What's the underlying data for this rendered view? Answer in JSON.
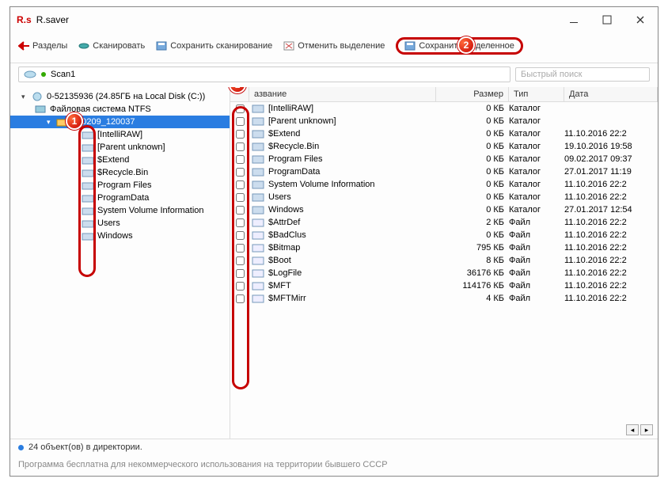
{
  "app": {
    "logo": "R.s",
    "title": "R.saver"
  },
  "toolbar": {
    "back": "Разделы",
    "scan": "Сканировать",
    "save_scan": "Сохранить сканирование",
    "deselect": "Отменить выделение",
    "save_selected": "Сохранить выделенное"
  },
  "path": {
    "scan_name": "Scan1"
  },
  "search": {
    "placeholder": "Быстрый поиск"
  },
  "tree": {
    "root": "0-52135936 (24.85ГБ на Local Disk (C:))",
    "fs": "Файловая система NTFS",
    "scan_folder": "170209_120037",
    "items": [
      "[IntelliRAW]",
      "[Parent unknown]",
      "$Extend",
      "$Recycle.Bin",
      "Program Files",
      "ProgramData",
      "System Volume Information",
      "Users",
      "Windows"
    ]
  },
  "columns": {
    "name": "азвание",
    "size": "Размер",
    "type": "Тип",
    "date": "Дата"
  },
  "rows": [
    {
      "name": "[IntelliRAW]",
      "size": "0 КБ",
      "type": "Каталог",
      "date": "",
      "folder": true
    },
    {
      "name": "[Parent unknown]",
      "size": "0 КБ",
      "type": "Каталог",
      "date": "",
      "folder": true
    },
    {
      "name": "$Extend",
      "size": "0 КБ",
      "type": "Каталог",
      "date": "11.10.2016 22:2",
      "folder": true
    },
    {
      "name": "$Recycle.Bin",
      "size": "0 КБ",
      "type": "Каталог",
      "date": "19.10.2016 19:58",
      "folder": true
    },
    {
      "name": "Program Files",
      "size": "0 КБ",
      "type": "Каталог",
      "date": "09.02.2017 09:37",
      "folder": true
    },
    {
      "name": "ProgramData",
      "size": "0 КБ",
      "type": "Каталог",
      "date": "27.01.2017 11:19",
      "folder": true
    },
    {
      "name": "System Volume Information",
      "size": "0 КБ",
      "type": "Каталог",
      "date": "11.10.2016 22:2",
      "folder": true
    },
    {
      "name": "Users",
      "size": "0 КБ",
      "type": "Каталог",
      "date": "11.10.2016 22:2",
      "folder": true
    },
    {
      "name": "Windows",
      "size": "0 КБ",
      "type": "Каталог",
      "date": "27.01.2017 12:54",
      "folder": true
    },
    {
      "name": "$AttrDef",
      "size": "2 КБ",
      "type": "Файл",
      "date": "11.10.2016 22:2",
      "folder": false
    },
    {
      "name": "$BadClus",
      "size": "0 КБ",
      "type": "Файл",
      "date": "11.10.2016 22:2",
      "folder": false
    },
    {
      "name": "$Bitmap",
      "size": "795 КБ",
      "type": "Файл",
      "date": "11.10.2016 22:2",
      "folder": false
    },
    {
      "name": "$Boot",
      "size": "8 КБ",
      "type": "Файл",
      "date": "11.10.2016 22:2",
      "folder": false
    },
    {
      "name": "$LogFile",
      "size": "36176 КБ",
      "type": "Файл",
      "date": "11.10.2016 22:2",
      "folder": false
    },
    {
      "name": "$MFT",
      "size": "114176 КБ",
      "type": "Файл",
      "date": "11.10.2016 22:2",
      "folder": false
    },
    {
      "name": "$MFTMirr",
      "size": "4 КБ",
      "type": "Файл",
      "date": "11.10.2016 22:2",
      "folder": false
    }
  ],
  "status": "24 объект(ов) в директории.",
  "footer": "Программа бесплатна для некоммерческого использования на территории бывшего СССР",
  "bubbles": {
    "one": "1",
    "two": "2"
  }
}
